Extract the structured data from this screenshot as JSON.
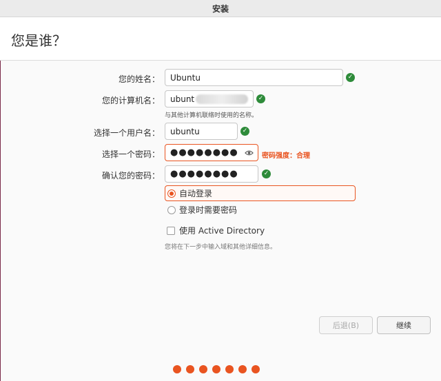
{
  "window": {
    "title": "安装"
  },
  "page": {
    "title": "您是谁？"
  },
  "form": {
    "name": {
      "label": "您的姓名：",
      "value": "Ubuntu"
    },
    "computer_name": {
      "label": "您的计算机名：",
      "value": "ubunt",
      "hint": "与其他计算机联络时使用的名称。"
    },
    "username": {
      "label": "选择一个用户名：",
      "value": "ubuntu"
    },
    "password": {
      "label": "选择一个密码：",
      "value": "●●●●●●●●",
      "strength": "密码强度：合理"
    },
    "confirm_password": {
      "label": "确认您的密码：",
      "value": "●●●●●●●●"
    }
  },
  "login_options": {
    "auto_login": "自动登录",
    "require_password": "登录时需要密码",
    "selected": "auto_login"
  },
  "active_directory": {
    "label": "使用 Active Directory",
    "checked": false,
    "hint": "您将在下一步中输入域和其他详细信息。"
  },
  "buttons": {
    "back": "后退(B)",
    "next": "继续"
  },
  "progress": {
    "total_steps": 7
  },
  "colors": {
    "accent": "#e95420",
    "valid": "#2e8b3a"
  }
}
